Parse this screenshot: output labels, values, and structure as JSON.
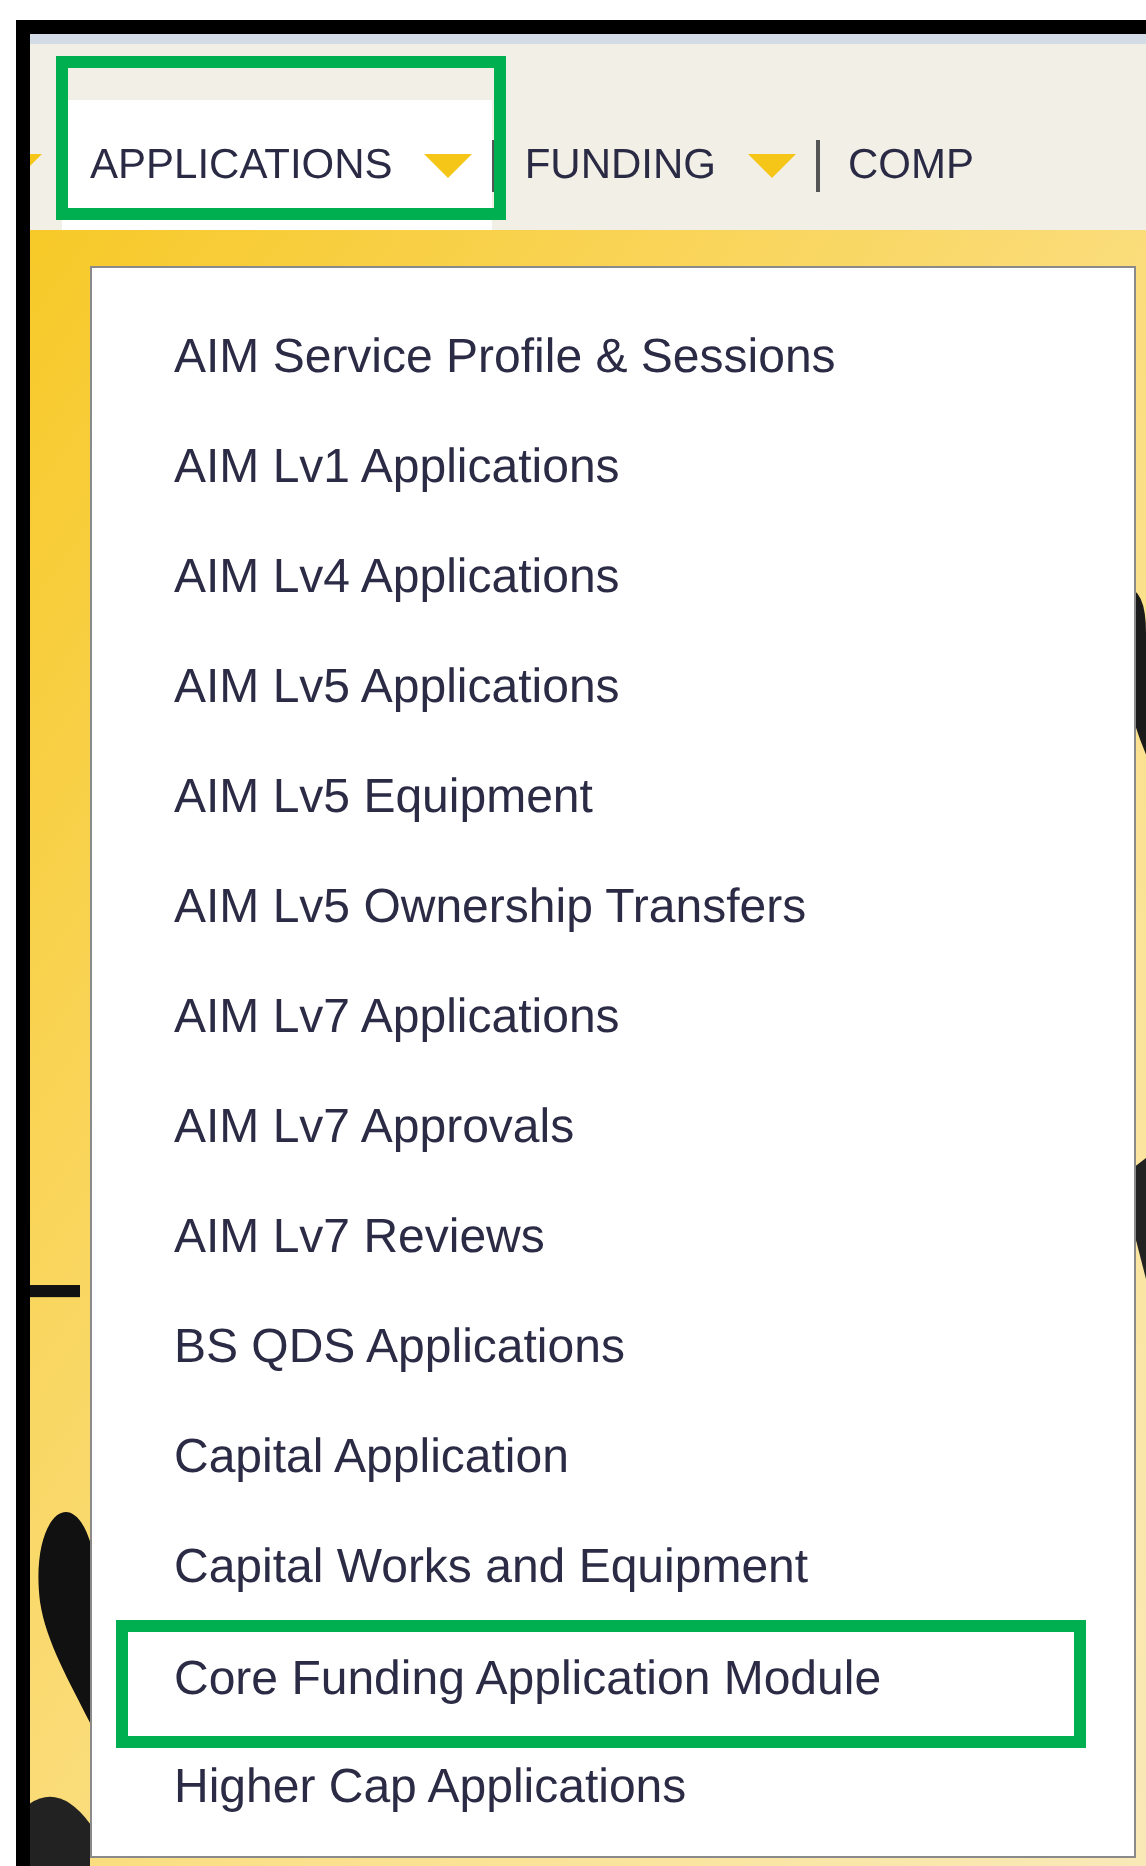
{
  "nav": {
    "items": [
      {
        "label": "APPLICATIONS",
        "caret": true,
        "selected": true,
        "highlighted": true
      },
      {
        "label": "FUNDING",
        "caret": true,
        "selected": false,
        "highlighted": false
      },
      {
        "label": "COMP",
        "caret": false,
        "selected": false,
        "highlighted": false
      }
    ]
  },
  "menu": {
    "items": [
      {
        "label": "AIM Service Profile & Sessions",
        "highlighted": false
      },
      {
        "label": "AIM Lv1 Applications",
        "highlighted": false
      },
      {
        "label": "AIM Lv4 Applications",
        "highlighted": false
      },
      {
        "label": "AIM Lv5 Applications",
        "highlighted": false
      },
      {
        "label": "AIM Lv5 Equipment",
        "highlighted": false
      },
      {
        "label": "AIM Lv5 Ownership Transfers",
        "highlighted": false
      },
      {
        "label": "AIM Lv7 Applications",
        "highlighted": false
      },
      {
        "label": "AIM Lv7 Approvals",
        "highlighted": false
      },
      {
        "label": "AIM Lv7 Reviews",
        "highlighted": false
      },
      {
        "label": "BS QDS Applications",
        "highlighted": false
      },
      {
        "label": "Capital Application",
        "highlighted": false
      },
      {
        "label": "Capital Works and Equipment",
        "highlighted": false
      },
      {
        "label": "Core Funding Application Module",
        "highlighted": true
      },
      {
        "label": "Higher Cap Applications",
        "highlighted": false
      }
    ]
  }
}
